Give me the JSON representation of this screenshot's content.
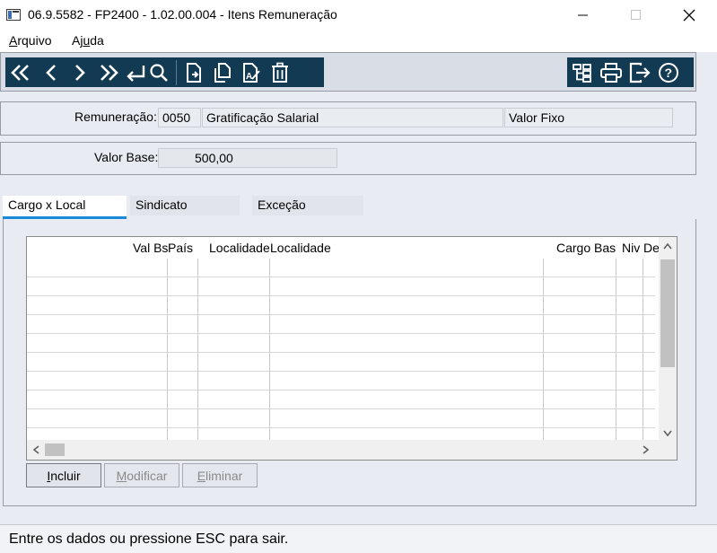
{
  "window": {
    "title": "06.9.5582 - FP2400 - 1.02.00.004 - Itens Remuneração",
    "minimize_glyph": "—",
    "maximize_glyph": "☐",
    "close_glyph": "✕"
  },
  "menu": {
    "arquivo": {
      "mnemonic": "A",
      "rest": "rquivo"
    },
    "ajuda": {
      "pre": "Aj",
      "mnemonic": "u",
      "rest": "da"
    }
  },
  "toolbar": {
    "nav_icons": [
      "first-icon",
      "previous-icon",
      "next-icon",
      "last-icon",
      "return-icon",
      "search-icon"
    ],
    "edit_icons": [
      "new-document-icon",
      "copy-document-icon",
      "edit-document-icon",
      "delete-icon"
    ],
    "right_icons": [
      "structure-icon",
      "print-icon",
      "exit-icon",
      "help-icon"
    ],
    "background": "#123a53"
  },
  "remuneracao": {
    "label": "Remuneração:",
    "code": "0050",
    "description": "Gratificação Salarial",
    "type": "Valor Fixo"
  },
  "valor_base": {
    "label": "Valor Base:",
    "value": "500,00"
  },
  "tabs": [
    {
      "label": "Cargo x Local",
      "active": true
    },
    {
      "label": "Sindicato",
      "active": false
    },
    {
      "label": "Exceção",
      "active": false
    }
  ],
  "grid": {
    "columns": [
      "Val Bs",
      "País",
      "Localidade",
      "Localidade",
      "Cargo Bas",
      "Niv",
      "De"
    ]
  },
  "actions": {
    "incluir": {
      "mnemonic": "I",
      "rest": "ncluir"
    },
    "modificar": {
      "mnemonic": "M",
      "rest": "odificar"
    },
    "eliminar": {
      "mnemonic": "E",
      "rest": "liminar"
    }
  },
  "status": {
    "message": "Entre os dados ou pressione ESC para sair."
  },
  "colors": {
    "accent_tab": "#1b8ad6",
    "toolbar": "#123a53"
  }
}
